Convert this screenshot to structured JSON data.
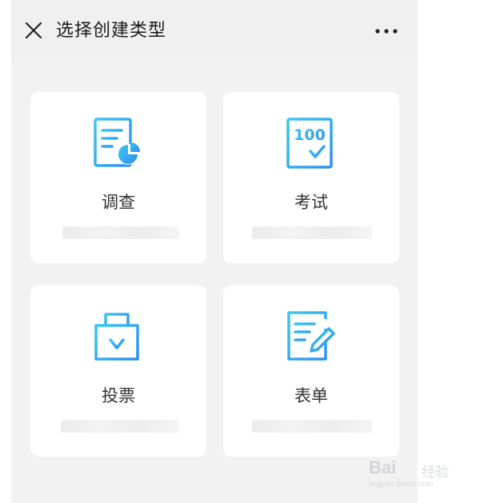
{
  "header": {
    "title": "选择创建类型"
  },
  "cards": [
    {
      "label": "调查",
      "icon": "survey-icon"
    },
    {
      "label": "考试",
      "icon": "exam-icon",
      "icon_text": "100"
    },
    {
      "label": "投票",
      "icon": "vote-icon"
    },
    {
      "label": "表单",
      "icon": "form-icon"
    }
  ],
  "watermark": {
    "brand": "Bai",
    "brand_cn": "经验",
    "url": "jingyan.baidu.com"
  },
  "colors": {
    "icon_gradient_start": "#3cc6f0",
    "icon_gradient_end": "#2f8ff0",
    "background": "#f2f2f3",
    "card": "#ffffff"
  }
}
